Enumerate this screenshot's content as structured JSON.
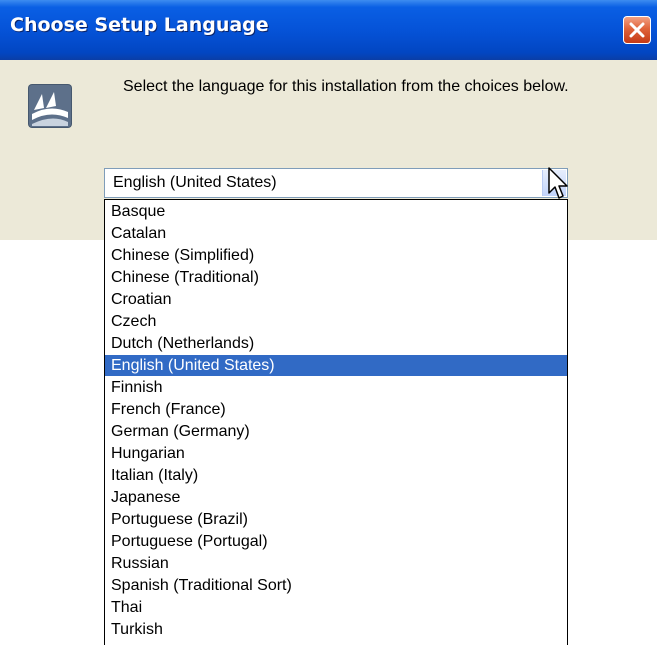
{
  "window": {
    "title": "Choose Setup Language",
    "close_icon": "close-icon"
  },
  "body": {
    "icon": "setup-app-icon",
    "prompt": "Select the language for this installation from the choices below."
  },
  "language_select": {
    "selected": "English (United States)",
    "arrow_icon": "chevron-down-icon",
    "options": [
      "Basque",
      "Catalan",
      "Chinese (Simplified)",
      "Chinese (Traditional)",
      "Croatian",
      "Czech",
      "Dutch (Netherlands)",
      "English (United States)",
      "Finnish",
      "French (France)",
      "German (Germany)",
      "Hungarian",
      "Italian (Italy)",
      "Japanese",
      "Portuguese (Brazil)",
      "Portuguese (Portugal)",
      "Russian",
      "Spanish (Traditional Sort)",
      "Thai",
      "Turkish"
    ],
    "highlighted_index": 7
  },
  "colors": {
    "title_bar": "#0553d8",
    "selection": "#316ac5",
    "dialog_face": "#ece9d8",
    "close_button": "#e0633a"
  }
}
